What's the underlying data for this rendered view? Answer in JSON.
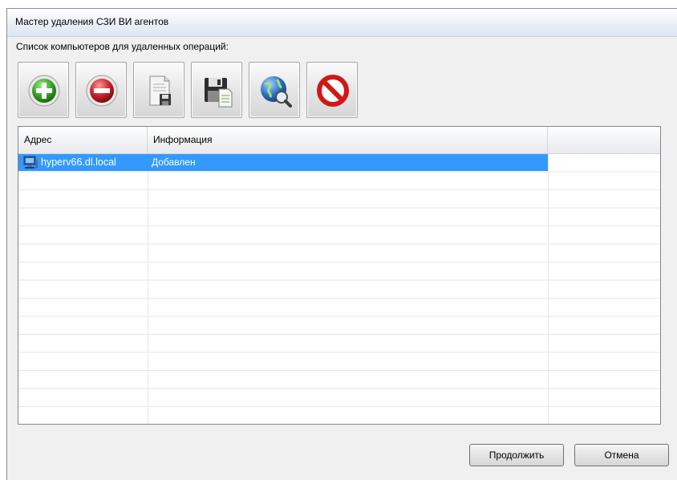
{
  "window": {
    "title": "Мастер удаления СЗИ ВИ агентов"
  },
  "subtitle": "Список компьютеров для удаленных операций:",
  "toolbar": {
    "buttons": [
      {
        "icon": "add-icon",
        "color": "#3aa02a"
      },
      {
        "icon": "remove-icon",
        "color": "#c8202a"
      },
      {
        "icon": "load-file-icon",
        "color": "#8a8a8a"
      },
      {
        "icon": "save-icon",
        "color": "#2e2e2e"
      },
      {
        "icon": "network-search-icon",
        "color": "#2a6fc0"
      },
      {
        "icon": "stop-icon",
        "color": "#d01818"
      }
    ]
  },
  "table": {
    "columns": [
      "Адрес",
      "Информация",
      ""
    ],
    "rows": [
      {
        "address": "hyperv66.dl.local",
        "info": "Добавлен",
        "selected": true
      }
    ]
  },
  "buttons": {
    "continue": "Продолжить",
    "cancel": "Отмена"
  }
}
